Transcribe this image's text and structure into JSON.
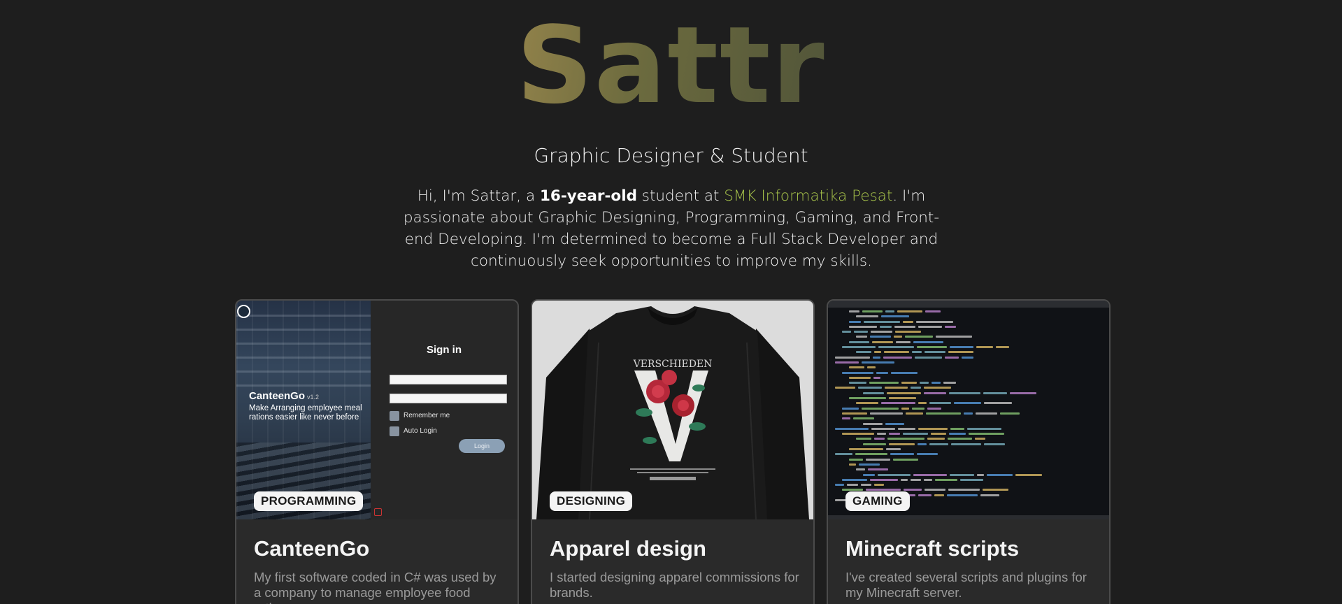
{
  "hero": {
    "logo": "Sattr",
    "subtitle": "Graphic Designer & Student",
    "intro": {
      "part1": "Hi, I'm Sattar, a ",
      "age": "16-year-old",
      "part2": " student at ",
      "school": "SMK Informatika Pesat",
      "part3": ". I'm passionate about Graphic Designing, Programming, Gaming, and Front-end Developing. I'm determined to become a Full Stack Developer and continuously seek opportunities to improve my skills."
    }
  },
  "colors": {
    "background": "#1e1e1e",
    "card": "#2a2a2a",
    "school_accent": "#a7c34a",
    "tag_bg": "#f4f4f4"
  },
  "projects": [
    {
      "category": "PROGRAMMING",
      "title": "CanteenGo",
      "description": "My first software coded in C# was used by a company to manage employee food rations.",
      "preview": {
        "app_name": "CanteenGo",
        "version": "v1.2",
        "tagline": "Make Arranging employee meal rations easier like never before",
        "signin_title": "Sign in",
        "remember_label": "Remember me",
        "autologin_label": "Auto Login",
        "login_button": "Login"
      }
    },
    {
      "category": "DESIGNING",
      "title": "Apparel design",
      "description": "I started designing apparel commissions for brands.",
      "preview": {
        "print_text": "VERSCHIEDEN",
        "letter": "V"
      }
    },
    {
      "category": "GAMING",
      "title": "Minecraft scripts",
      "description": "I've created several scripts and plugins for my Minecraft server."
    }
  ]
}
